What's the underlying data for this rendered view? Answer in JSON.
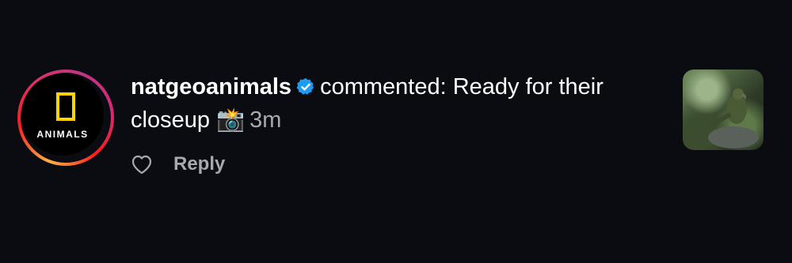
{
  "notification": {
    "username": "natgeoanimals",
    "verified": true,
    "comment_text": "commented: Ready for their closeup",
    "emoji": "📸",
    "timestamp": "3m",
    "reply_label": "Reply",
    "avatar_text": "ANIMALS",
    "icons": {
      "verified": "verified-badge-icon",
      "like": "heart-outline-icon"
    },
    "colors": {
      "background": "#0b0c12",
      "verified_badge": "#1d9bf0",
      "secondary_text": "#a8a8b3",
      "natgeo_yellow": "#ffd200"
    }
  }
}
